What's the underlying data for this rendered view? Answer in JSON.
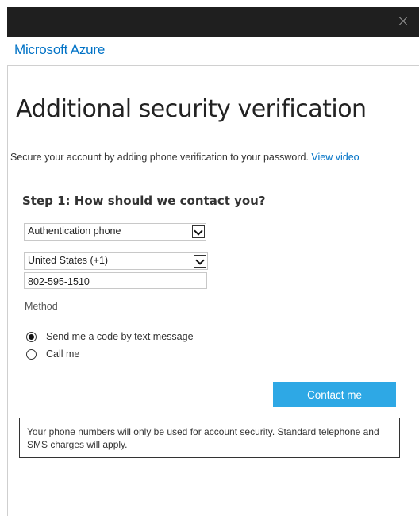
{
  "window": {
    "close_icon": "close-icon"
  },
  "header": {
    "brand": "Microsoft Azure"
  },
  "page": {
    "title": "Additional security verification",
    "intro_text": "Secure your account by adding phone verification to your password.",
    "intro_link": "View video"
  },
  "step1": {
    "title": "Step 1: How should we contact you?",
    "contact_method_selected": "Authentication phone",
    "country_selected": "United States (+1)",
    "phone_value": "802-595-1510",
    "method_label": "Method",
    "options": [
      {
        "label": "Send me a code by text message",
        "checked": true
      },
      {
        "label": "Call me",
        "checked": false
      }
    ],
    "contact_button": "Contact me"
  },
  "notice": {
    "text": "Your phone numbers will only be used for account security. Standard telephone and SMS charges will apply."
  },
  "colors": {
    "brand": "#0072c6",
    "button": "#2ea8e5",
    "titlebar": "#1f1f1f"
  }
}
